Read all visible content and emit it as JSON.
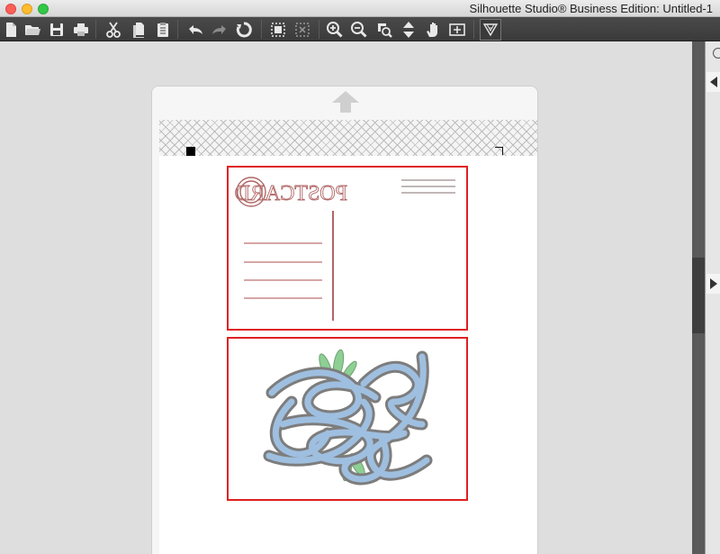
{
  "window": {
    "title": "Silhouette Studio® Business Edition: Untitled-1"
  },
  "toolbar": {
    "buttons": [
      {
        "name": "new-document-icon"
      },
      {
        "name": "open-folder-icon"
      },
      {
        "name": "save-icon"
      },
      {
        "name": "print-icon"
      },
      {
        "name": "cut-icon"
      },
      {
        "name": "copy-icon"
      },
      {
        "name": "paste-icon"
      },
      {
        "name": "undo-icon"
      },
      {
        "name": "redo-icon"
      },
      {
        "name": "redraw-icon"
      },
      {
        "name": "select-all-icon"
      },
      {
        "name": "deselect-icon"
      },
      {
        "name": "zoom-in-icon"
      },
      {
        "name": "zoom-out-icon"
      },
      {
        "name": "zoom-select-icon"
      },
      {
        "name": "drag-zoom-icon"
      },
      {
        "name": "pan-hand-icon"
      },
      {
        "name": "fit-to-page-icon"
      },
      {
        "name": "design-store-icon"
      }
    ]
  },
  "canvas": {
    "postcard_text": "POSTCARD",
    "colors": {
      "cut_line": "#e02020",
      "postcard_lines": "#b06666",
      "art_blue": "#9fbfe0",
      "art_outline": "#7d7d7d",
      "art_green": "#8ecf94"
    }
  }
}
